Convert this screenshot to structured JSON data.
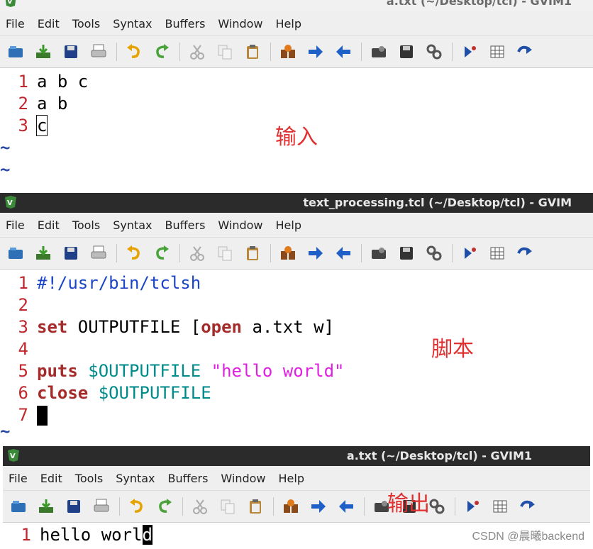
{
  "windows": [
    {
      "title": "a.txt (~/Desktop/tcl) - GVIM1",
      "menu": [
        "File",
        "Edit",
        "Tools",
        "Syntax",
        "Buffers",
        "Window",
        "Help"
      ],
      "lines": [
        {
          "num": "1",
          "text": "a b c"
        },
        {
          "num": "2",
          "text": "a b"
        },
        {
          "num": "3",
          "text": "c"
        }
      ],
      "tildes": [
        "~",
        "~"
      ],
      "annotation": "输入"
    },
    {
      "title": "text_processing.tcl (~/Desktop/tcl) - GVIM",
      "menu": [
        "File",
        "Edit",
        "Tools",
        "Syntax",
        "Buffers",
        "Window",
        "Help"
      ],
      "lines": [
        {
          "num": "1",
          "path": "#!/usr/bin/tclsh"
        },
        {
          "num": "2"
        },
        {
          "num": "3",
          "kw1": "set",
          "text": " OUTPUTFILE [",
          "kw2": "open",
          "text2": " a.txt w]"
        },
        {
          "num": "4"
        },
        {
          "num": "5",
          "kw": "puts",
          "var": "$OUTPUTFILE",
          "str": "\"hello world\""
        },
        {
          "num": "6",
          "kw": "close",
          "var": "$OUTPUTFILE"
        },
        {
          "num": "7"
        }
      ],
      "tildes": [
        "~"
      ],
      "annotation": "脚本"
    },
    {
      "title": "a.txt (~/Desktop/tcl) - GVIM1",
      "menu": [
        "File",
        "Edit",
        "Tools",
        "Syntax",
        "Buffers",
        "Window",
        "Help"
      ],
      "lines": [
        {
          "num": "1",
          "text": "hello worl",
          "cursor": "d"
        }
      ],
      "annotation": "输出"
    }
  ],
  "toolbar_icons": [
    "open-icon",
    "save-download-icon",
    "save-icon",
    "print-icon",
    "undo-icon",
    "redo-icon",
    "cut-icon",
    "copy-icon",
    "paste-icon",
    "find-replace-icon",
    "find-next-icon",
    "find-prev-icon",
    "load-session-icon",
    "save-session-icon",
    "run-script-icon",
    "make-icon",
    "shell-icon",
    "tags-icon"
  ],
  "watermark": "CSDN @晨曦backend",
  "colors": {
    "line_number": "#c0282d",
    "keyword": "#a52a2a",
    "path": "#1a45c8",
    "variable": "#008b8b",
    "string": "#e020e0",
    "annotation": "#e03030"
  }
}
